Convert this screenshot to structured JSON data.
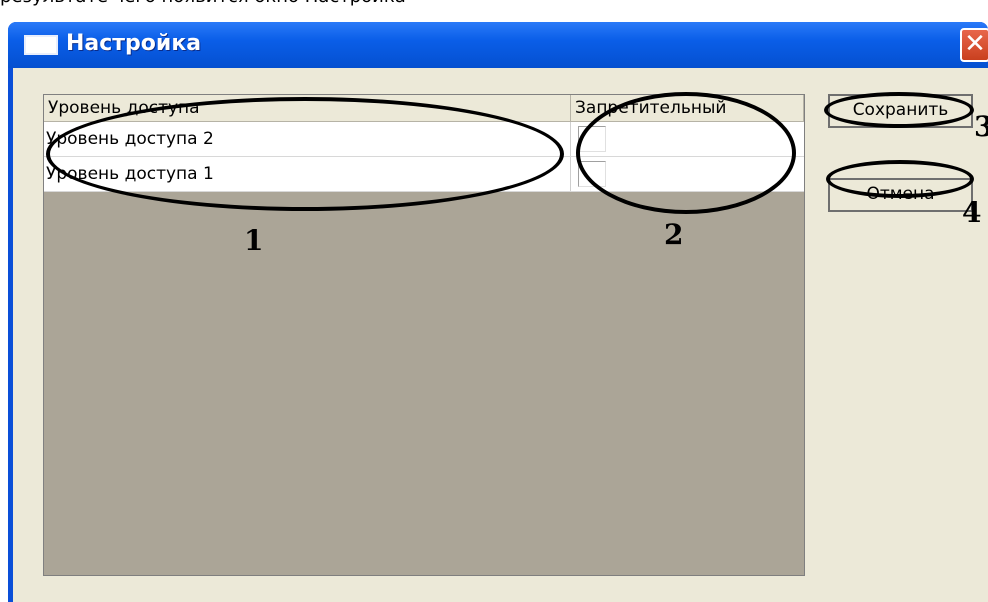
{
  "doc_strip_text": "результате чего появится окно Настройка",
  "window": {
    "title": "Настройка",
    "close_glyph": "✕"
  },
  "grid": {
    "columns": [
      "Уровень доступа",
      "Запретительный"
    ],
    "rows": [
      {
        "name": "Уровень доступа 2",
        "prohibitive": false
      },
      {
        "name": "Уровень доступа 1",
        "prohibitive": false
      }
    ]
  },
  "buttons": {
    "save": "Сохранить",
    "cancel": "Отмена"
  },
  "annotations": {
    "n1": "1",
    "n2": "2",
    "n3": "3",
    "n4": "4"
  }
}
